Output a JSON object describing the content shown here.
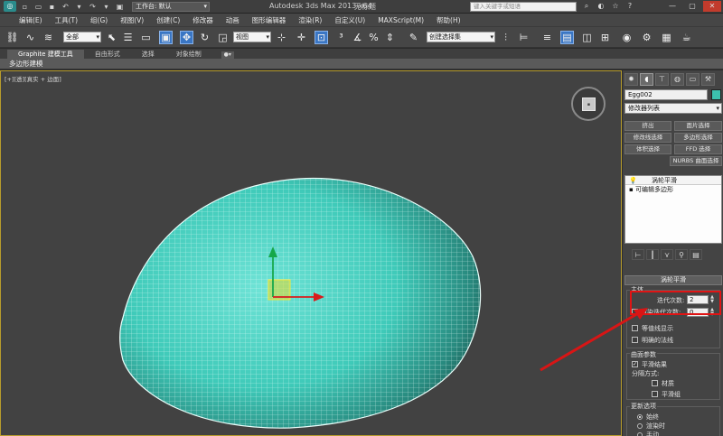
{
  "titlebar": {
    "workspace_label": "工作台: 默认",
    "app_title": "Autodesk 3ds Max  2013 x64",
    "file_name": "无标题",
    "search_placeholder": "键入关键字或短语",
    "logo": "3ds-max-logo"
  },
  "menu": [
    "编辑(E)",
    "工具(T)",
    "组(G)",
    "视图(V)",
    "创建(C)",
    "修改器",
    "动画",
    "图形编辑器",
    "渲染(R)",
    "自定义(U)",
    "MAXScript(M)",
    "帮助(H)"
  ],
  "toolbar": {
    "selection_filter": "全部",
    "ref_coord": "视图",
    "named_selection": "创建选择集"
  },
  "ribbon": {
    "tabs": [
      "Graphite 建模工具",
      "自由形式",
      "选择",
      "对象绘制"
    ],
    "sub_label": "多边形建模"
  },
  "viewport": {
    "label": "[+][透][真实 + 边面]",
    "colors": {
      "mesh": "#4fd3c3",
      "wire": "#e8fffb",
      "border": "#b79c2c"
    }
  },
  "command_panel": {
    "object_name": "Egg002",
    "object_color": "#3cc1ad",
    "modifier_list": "修改器列表",
    "buttons": [
      "挤出",
      "面片选择",
      "修改线选择",
      "多边形选择",
      "体积选择",
      "FFD 选择",
      "NURBS 曲面选择"
    ],
    "stack": [
      "涡轮平滑",
      "可编辑多边形"
    ],
    "rollout_title": "涡轮平滑",
    "main_label": "主体",
    "iterations_label": "迭代次数:",
    "iterations_value": "2",
    "render_iters_label": "渲染迭代次数:",
    "render_iters_value": "0",
    "isoline_label": "等值线显示",
    "explicit_normals_label": "明确的法线",
    "surface_params_label": "曲面参数",
    "smooth_result_label": "平滑结果",
    "separate_by_label": "分隔方式:",
    "materials_label": "材质",
    "smoothing_groups_label": "平滑组",
    "update_options_label": "更新选项",
    "always_label": "始终",
    "on_render_label": "渲染时",
    "manual_label": "手动"
  }
}
